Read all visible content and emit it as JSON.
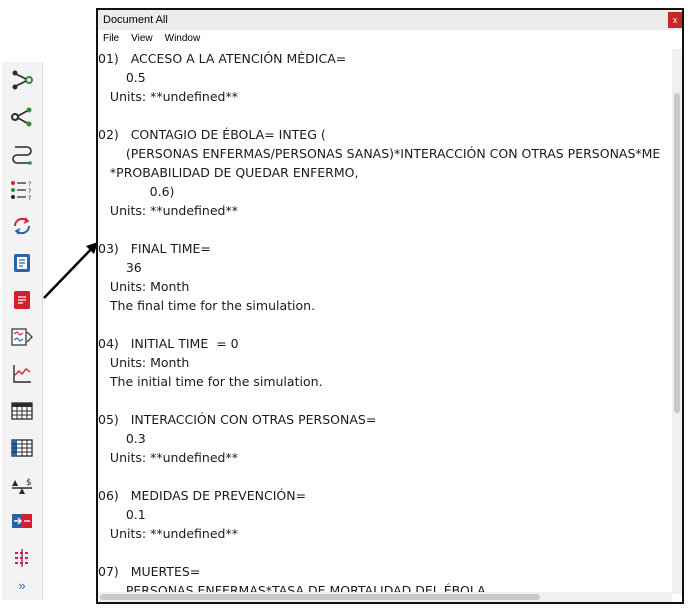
{
  "window": {
    "title": "Document All",
    "close_label": "x",
    "menu": [
      "File",
      "View",
      "Window"
    ]
  },
  "doc_lines": [
    "01)   ACCESO A LA ATENCIÓN MÉDICA=",
    "       0.5",
    "   Units: **undefined**",
    "",
    "02)   CONTAGIO DE ÉBOLA= INTEG (",
    "       (PERSONAS ENFERMAS/PERSONAS SANAS)*INTERACCIÓN CON OTRAS PERSONAS*ME",
    "   *PROBABILIDAD DE QUEDAR ENFERMO,",
    "             0.6)",
    "   Units: **undefined**",
    "",
    "03)   FINAL TIME=",
    "       36",
    "   Units: Month",
    "   The final time for the simulation.",
    "",
    "04)   INITIAL TIME  = 0",
    "   Units: Month",
    "   The initial time for the simulation.",
    "",
    "05)   INTERACCIÓN CON OTRAS PERSONAS=",
    "       0.3",
    "   Units: **undefined**",
    "",
    "06)   MEDIDAS DE PREVENCIÓN=",
    "       0.1",
    "   Units: **undefined**",
    "",
    "07)   MUERTES=",
    "       PERSONAS ENFERMAS*TASA DE MORTALIDAD DEL ÉBOLA"
  ],
  "toolbar": {
    "tools": [
      "causes-tree-icon",
      "uses-tree-icon",
      "loops-icon",
      "causes-strip-icon",
      "refresh-icon",
      "document-icon",
      "document-all-icon",
      "table-time-icon",
      "graph-icon",
      "table-icon",
      "runs-compare-icon",
      "balance-icon",
      "import-icon",
      "settings-icon"
    ],
    "more_label": "»"
  },
  "colors": {
    "accent_blue": "#2a62a8",
    "highlight_red": "#d61f2c",
    "text": "#1a1a1a",
    "close_red": "#c62828"
  }
}
